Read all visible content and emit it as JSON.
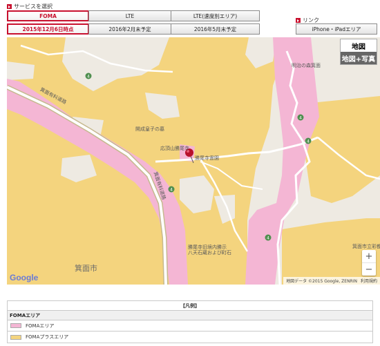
{
  "service": {
    "label": "サービスを選択",
    "tabs": [
      {
        "label": "FOMA",
        "active": true
      },
      {
        "label": "LTE",
        "active": false
      },
      {
        "label": "LTE(速度別エリア)",
        "active": false
      }
    ]
  },
  "time": {
    "tabs": [
      {
        "label": "2015年12月6日時点",
        "active": true
      },
      {
        "label": "2016年2月末予定",
        "active": false
      },
      {
        "label": "2016年5月末予定",
        "active": false
      }
    ]
  },
  "links": {
    "label": "リンク",
    "button": "iPhone・iPadエリア"
  },
  "map": {
    "type_control": {
      "map": "地図",
      "satellite": "地図+写真"
    },
    "zoom": {
      "in": "+",
      "out": "−"
    },
    "labels": {
      "park": "明治の森箕面",
      "expressway": "箕面有料道路",
      "expressway2": "箕面有料道路",
      "tomb": "開成皇子の墓",
      "temple": "応頂山勝尾寺",
      "cemetery": "勝尾寺霊園",
      "building": "勝尾寺旧境内勝示\n八天石蔵および町石",
      "school": "箕面市立彩都の",
      "city": "箕面市"
    },
    "route_numbers": [
      "4",
      "4",
      "4",
      "4",
      "4"
    ],
    "google_logo": "Google",
    "attribution": "地図データ ©2015 Google, ZENRIN",
    "terms": "利用規約"
  },
  "legend": {
    "region": "【凡例】",
    "heading": "FOMAエリア",
    "items": [
      {
        "label": "FOMAエリア",
        "color": "#f4b6d4"
      },
      {
        "label": "FOMAプラスエリア",
        "color": "#f4d47e"
      }
    ]
  },
  "colors": {
    "accent": "#c8102e",
    "foma": "#f4b6d4",
    "foma_plus": "#f4d47e",
    "base": "#eeeae2"
  }
}
